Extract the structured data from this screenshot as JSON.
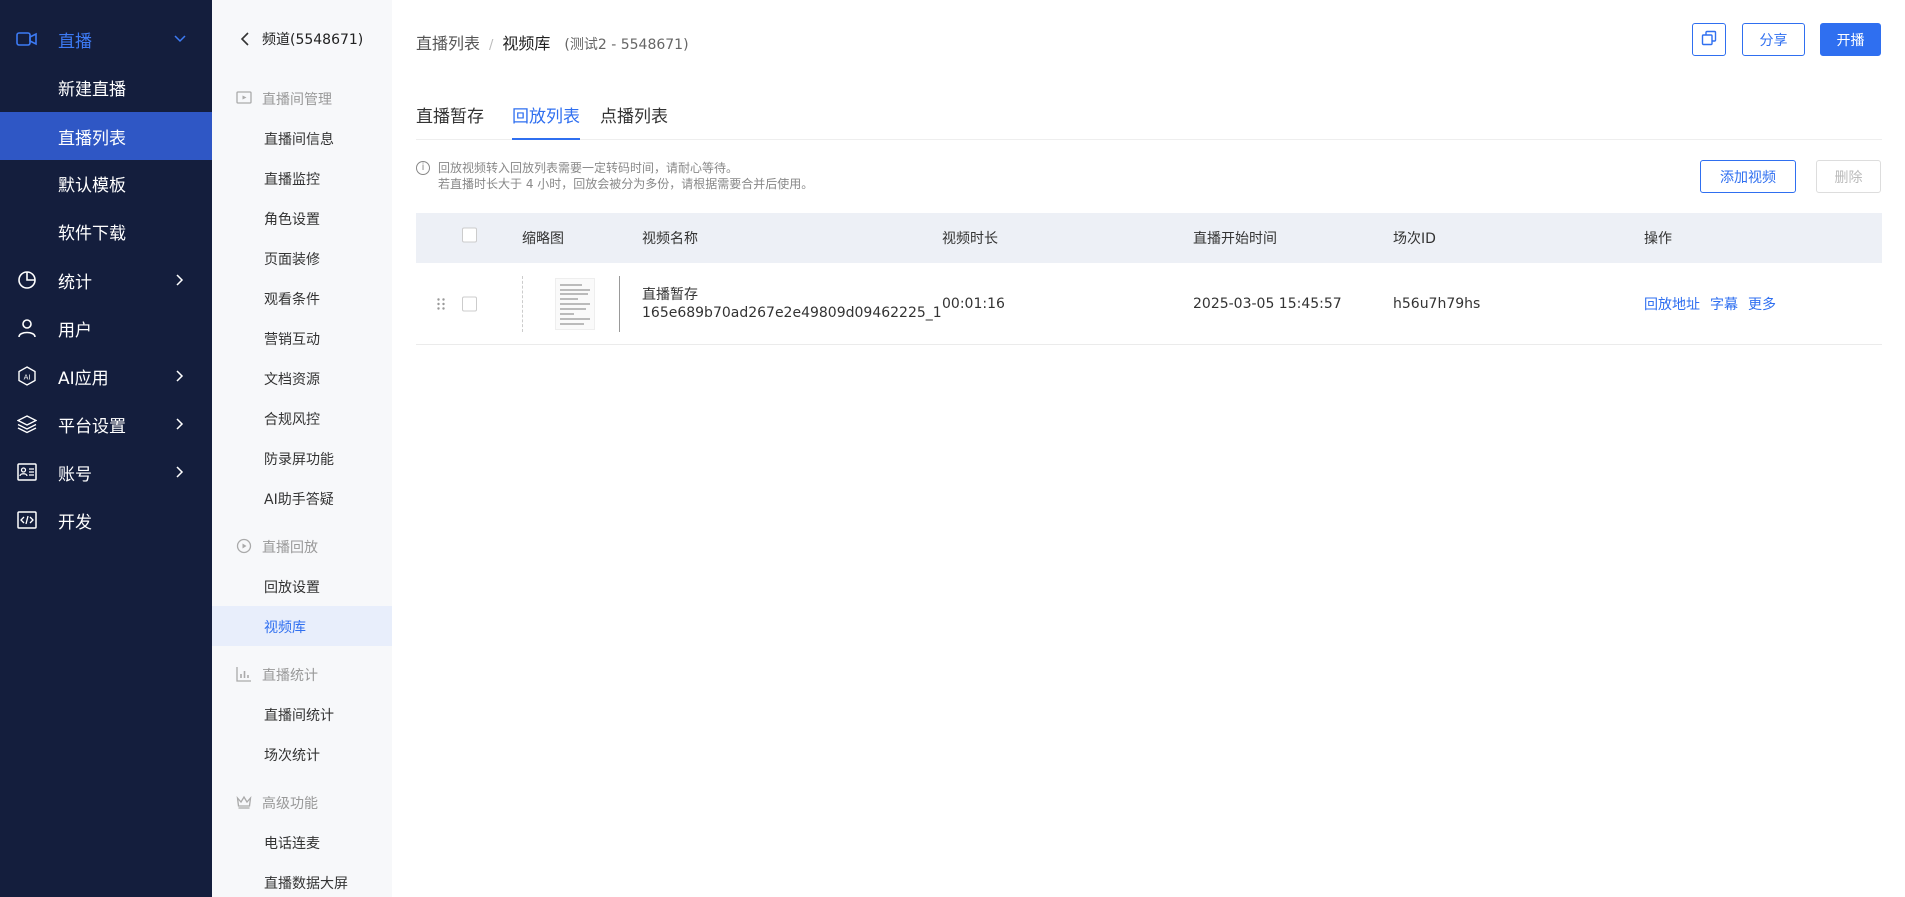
{
  "nav_primary": {
    "top": {
      "label": "直播",
      "icon": "video-camera-icon"
    },
    "sub": [
      {
        "label": "新建直播"
      },
      {
        "label": "直播列表"
      },
      {
        "label": "默认模板"
      },
      {
        "label": "软件下载"
      }
    ],
    "items": [
      {
        "label": "统计",
        "icon": "pie-chart-icon"
      },
      {
        "label": "用户",
        "icon": "user-icon"
      },
      {
        "label": "AI应用",
        "icon": "ai-hexagon-icon"
      },
      {
        "label": "平台设置",
        "icon": "layers-icon"
      },
      {
        "label": "账号",
        "icon": "id-card-icon"
      },
      {
        "label": "开发",
        "icon": "code-icon"
      }
    ]
  },
  "nav_secondary": {
    "title": "频道(5548671)",
    "groups": [
      {
        "label": "直播间管理",
        "links": [
          "直播间信息",
          "直播监控",
          "角色设置",
          "页面装修",
          "观看条件",
          "营销互动",
          "文档资源",
          "合规风控",
          "防录屏功能",
          "AI助手答疑"
        ]
      },
      {
        "label": "直播回放",
        "links": [
          "回放设置",
          "视频库"
        ]
      },
      {
        "label": "直播统计",
        "links": [
          "直播间统计",
          "场次统计"
        ]
      },
      {
        "label": "高级功能",
        "links": [
          "电话连麦",
          "直播数据大屏"
        ]
      }
    ]
  },
  "breadcrumb": {
    "parent": "直播列表",
    "sep": "/",
    "current": "视频库",
    "note": "(测试2 - 5548671)"
  },
  "header": {
    "share": "分享",
    "live": "开播"
  },
  "tabs": [
    "直播暂存",
    "回放列表",
    "点播列表"
  ],
  "notice": {
    "line1": "回放视频转入回放列表需要一定转码时间，请耐心等待。",
    "line2": "若直播时长大于 4 小时，回放会被分为多份，请根据需要合并后使用。"
  },
  "actions": {
    "add": "添加视频",
    "delete": "删除"
  },
  "table": {
    "headers": [
      "缩略图",
      "视频名称",
      "视频时长",
      "直播开始时间",
      "场次ID",
      "操作"
    ],
    "rows": [
      {
        "name_line1": "直播暂存",
        "name_line2": "165e689b70ad267e2e49809d09462225_1",
        "duration": "00:01:16",
        "start": "2025-03-05 15:45:57",
        "session_id": "h56u7h79hs",
        "ops": [
          "回放地址",
          "字幕",
          "更多"
        ]
      }
    ]
  }
}
